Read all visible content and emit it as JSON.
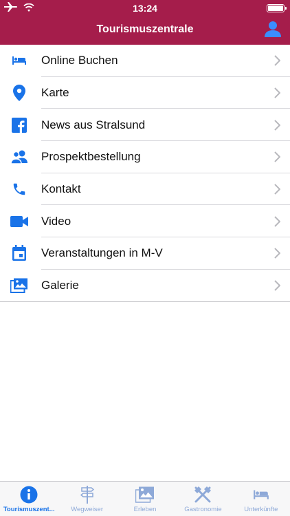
{
  "status_bar": {
    "time": "13:24"
  },
  "header": {
    "title": "Tourismuszentrale"
  },
  "menu": {
    "items": [
      {
        "label": "Online Buchen",
        "icon": "bed-icon"
      },
      {
        "label": "Karte",
        "icon": "map-pin-icon"
      },
      {
        "label": "News aus Stralsund",
        "icon": "facebook-icon"
      },
      {
        "label": "Prospektbestellung",
        "icon": "people-icon"
      },
      {
        "label": "Kontakt",
        "icon": "phone-icon"
      },
      {
        "label": "Video",
        "icon": "video-camera-icon"
      },
      {
        "label": "Veranstaltungen in M-V",
        "icon": "calendar-icon"
      },
      {
        "label": "Galerie",
        "icon": "gallery-icon"
      }
    ]
  },
  "tabbar": {
    "tabs": [
      {
        "label": "Tourismuszent...",
        "icon": "info-icon",
        "active": true
      },
      {
        "label": "Wegweiser",
        "icon": "signpost-icon",
        "active": false
      },
      {
        "label": "Erleben",
        "icon": "gallery-icon",
        "active": false
      },
      {
        "label": "Gastronomie",
        "icon": "cutlery-icon",
        "active": false
      },
      {
        "label": "Unterkünfte",
        "icon": "bed-icon",
        "active": false
      }
    ]
  },
  "colors": {
    "header": "#a51d4b",
    "accent": "#1a73e8",
    "tab_inactive": "#8ea9d8"
  }
}
